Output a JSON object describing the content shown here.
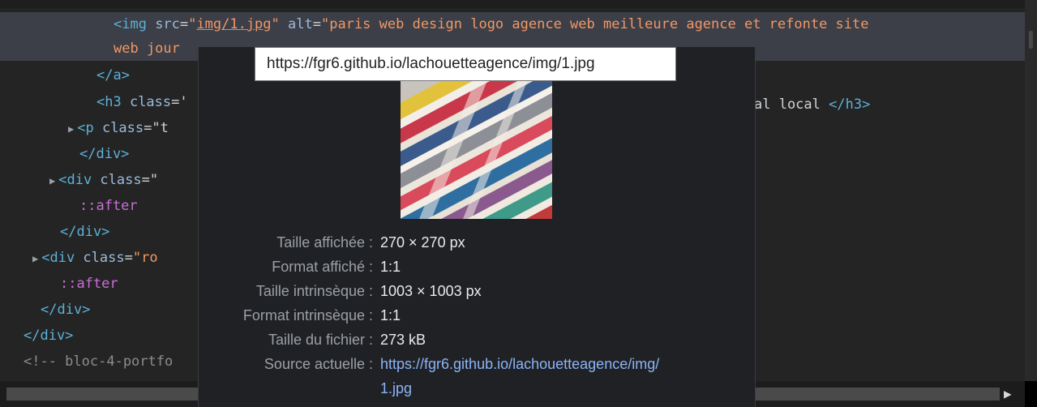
{
  "code_lines": [
    {
      "segments": [
        {
          "c": "tag",
          "t": "<img "
        },
        {
          "c": "attr",
          "t": "src"
        },
        {
          "c": "eq",
          "t": "="
        },
        {
          "c": "val",
          "t": "\""
        },
        {
          "c": "link",
          "t": "img/1.jpg"
        },
        {
          "c": "val",
          "t": "\""
        },
        {
          "c": "eq",
          "t": " "
        },
        {
          "c": "attr",
          "t": "alt"
        },
        {
          "c": "eq",
          "t": "="
        },
        {
          "c": "val",
          "t": "\"paris web design logo agence web meilleure agence et refonte site"
        }
      ]
    },
    {
      "segments": [
        {
          "c": "val",
          "t": "web jour"
        }
      ]
    },
    {
      "segments": [
        {
          "c": "tag",
          "t": "</a>"
        }
      ]
    },
    {
      "segments": [
        {
          "c": "tag",
          "t": "<h3 "
        },
        {
          "c": "attr",
          "t": "class"
        },
        {
          "c": "eq",
          "t": "='"
        }
      ]
    },
    {
      "segments": [
        {
          "c": "tag",
          "t": "<p "
        },
        {
          "c": "attr",
          "t": "class"
        },
        {
          "c": "eq",
          "t": "=\"t"
        }
      ]
    },
    {
      "segments": [
        {
          "c": "tag",
          "t": "</div>"
        }
      ]
    },
    {
      "segments": [
        {
          "c": "tag",
          "t": "<div "
        },
        {
          "c": "attr",
          "t": "class"
        },
        {
          "c": "eq",
          "t": "=\""
        }
      ]
    },
    {
      "segments": [
        {
          "c": "pseudo",
          "t": "::after"
        }
      ]
    },
    {
      "segments": [
        {
          "c": "tag",
          "t": "</div>"
        }
      ]
    },
    {
      "segments": [
        {
          "c": "tag",
          "t": "<div "
        },
        {
          "c": "attr",
          "t": "class"
        },
        {
          "c": "eq",
          "t": "="
        },
        {
          "c": "val",
          "t": "\"ro"
        }
      ]
    },
    {
      "segments": [
        {
          "c": "pseudo",
          "t": "::after"
        }
      ]
    },
    {
      "segments": [
        {
          "c": "tag",
          "t": "</div>"
        }
      ]
    },
    {
      "segments": [
        {
          "c": "tag",
          "t": "</div>"
        }
      ]
    },
    {
      "segments": [
        {
          "c": "cmt",
          "t": "<!-- bloc-4-portfo"
        }
      ]
    }
  ],
  "h3_tail": {
    "text": "al local ",
    "close": "</h3>"
  },
  "url_tooltip": "https://fgr6.github.io/lachouetteagence/img/1.jpg",
  "info": {
    "displayed_size_label": "Taille affichée :",
    "displayed_size_value": "270 × 270 px",
    "displayed_ratio_label": "Format affiché :",
    "displayed_ratio_value": "1:1",
    "intrinsic_size_label": "Taille intrinsèque :",
    "intrinsic_size_value": "1003 × 1003 px",
    "intrinsic_ratio_label": "Format intrinsèque :",
    "intrinsic_ratio_value": "1:1",
    "file_size_label": "Taille du fichier :",
    "file_size_value": "273 kB",
    "source_label": "Source actuelle :",
    "source_value_1": "https://fgr6.github.io/lachouetteagence/img/",
    "source_value_2": "1.jpg"
  },
  "colors": {
    "link": "#8ab4f8",
    "tag": "#5db0d7",
    "value": "#f29766",
    "pseudo": "#c96fd7"
  }
}
